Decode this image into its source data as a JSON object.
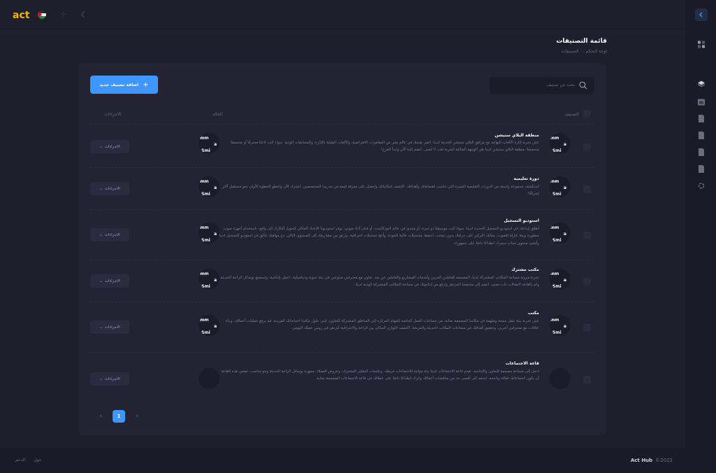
{
  "header": {
    "icons": [
      "act-logo",
      "jordan-flag-icon",
      "dots-icon",
      "moon-icon"
    ]
  },
  "page": {
    "title": "قائمة التصنيفات",
    "breadcrumb": [
      "لوحة التحكم",
      "-",
      "التصنيفات"
    ]
  },
  "toolbar": {
    "add_label": "اضافة تصنيف جديد",
    "search_placeholder": "بحث عن تصنيف"
  },
  "table": {
    "columns": {
      "category": "التصنيف",
      "status": "الحالة",
      "actions": "الاجراءات"
    },
    "rows": [
      {
        "title": "منطقة البلاي ستيشن",
        "desc": "عش تجربة إثارة الألعاب النهائية مع مرافق البلاي ستيشن الحديثة لدينا. اغمر نفسك في عالم مثير من المغامرات الافتراضية، والألعاب المليئة بالإثارة، والمسابقات الودية. سواء كنت لاعبًا محترفًا أو متحمسًا متحمسًا، منطقة البلاي ستيشن لدينا هي الوجهة المثالية لتجربة لعب لا تُنسى. انضم إلينا الآن وابدأ الفرح!",
        "action_label": "الاجراءات"
      },
      {
        "title": "دورة تعليمية",
        "desc": "استكشف مجموعة واسعة من الدورات التعليمية المثيرة التي تناسب اهتماماتك وأهدافك. اكتشف إمكانياتك واحصل على معرفة قيمة من مدربينا المتخصصين. اشترك الآن واخطو الخطوة الأولى نحو مستقبل أكثر إشراقًا!",
        "action_label": "الاجراءات"
      },
      {
        "title": "استوديو التسجيل",
        "desc": "أطلق إبداعك في استوديو التسجيل الحديث لدينا. سواء كنت موسيقيًا ذو خبرة، أو مبتدئ في عالم البودكاست، أو فنان أداء صوتي، يوفر استوديونا الإعداد المثالي لتحويل أفكارك إلى واقع. باستخدام أجهزة صوت متطورة وبيئة عازلة للصوت، يمكنك التركيز على حرفتك بدون تشتت. احتفظ بتسجيلات عالية الجودة، وأنتج تسجيلات احترافية، وارتق من مشاريعك إلى المستوى التالي. دع مواهبك تتألق في استوديو التسجيل لدينا وأنشئ محتوى جذاب سيترك انطباعًا دائمًا على جمهورك.",
        "action_label": "الاجراءات"
      },
      {
        "title": "مكتب مشترك",
        "desc": "تجربة مرونة مساحة المكاتب المشتركة لدينا، المصممة للعاملين الحرين وأصحاب المشاريع والعاملين عن بعد. تعاون مع محترفين متنوعين في بيئة حيوية وديناميكية، اعمل بإنتاجية، واستمتع بوسائل الراحة الحديثة، ولم بالقاعة لاتصالات ذات معنى. انضم إلى مجتمعنا المزدهر وارفع من إنتاجيتك في مساحة المكاتب المشتركة الودية لدينا.",
        "action_label": "الاجراءات"
      },
      {
        "title": "مكتب",
        "desc": "عش تجربة بيئة عمل منتجة وملهمة في مكاتبنا المصممة بعناية. من مساحات العمل الخاصة للمهام المركزة إلى المناطق المشتركة للتعاون، تلبي حلول مكتبنا احتياجاتك الفريدة. قم برفع عمليات أعمالك، وبناء علاقات مع محترفين آخرين، وتحقيق أهدافك في مساحات المكاتب الحديثة والمريحة. اكتشف التوازن المثالي بين الراحة والاحترافية لتزدهر في روتين عملك اليومي.",
        "action_label": "الاجراءات"
      },
      {
        "title": "قاعة الاجتماعات",
        "desc": "ادخل إلى مساحة مصممة للتعاون والإنتاجية. تقدم قاعة الاجتماعات لدينا بيئة مواتية للاجتماعات فريقك، وجلسات التفكير المشترك، وعروض العملاء. مجهزة بوسائل الراحة الحديثة وجو مناسب، تضمن هذه القاعة أن تكون اجتماعاتك فعالة وناجحة. استعد إلى أقصى حد من مناقشات أعمالك واترك انطباعًا دائمًا على عملائك في قاعة الاجتماعات المصممة بعناية.",
        "action_label": "الاجراءات"
      }
    ]
  },
  "pagination": {
    "current": "1",
    "prev": "‹",
    "next": "›"
  },
  "footer": {
    "year": "©2023",
    "brand": "Act Hub",
    "links": [
      "حول",
      "الدعم"
    ]
  },
  "colors": {
    "accent": "#3e97ff",
    "bg": "#1e1e2d",
    "card": "#232333"
  }
}
